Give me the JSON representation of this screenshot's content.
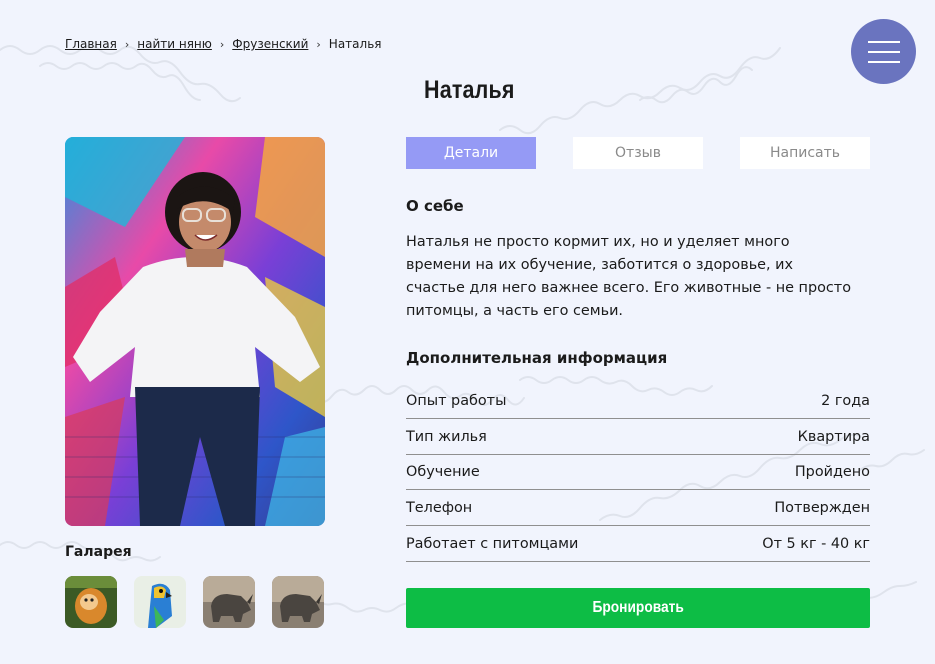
{
  "breadcrumb": {
    "items": [
      "Главная",
      "найти няню",
      "Фрузенский"
    ],
    "current": "Наталья"
  },
  "page": {
    "title": "Наталья"
  },
  "tabs": [
    {
      "label": "Детали",
      "active": true
    },
    {
      "label": "Отзыв",
      "active": false
    },
    {
      "label": "Написать",
      "active": false
    }
  ],
  "about": {
    "title": "О себе",
    "lines": [
      "Наталья не просто кормит их, но и уделяет много",
      "времени на их обучение, заботится о здоровье, их",
      "счастье для него важнее всего. Его животные - не просто",
      "питомцы, а часть его семьи."
    ]
  },
  "additional": {
    "title": "Дополнительная информация",
    "rows": [
      {
        "label": "Опыт работы",
        "value": "2 года"
      },
      {
        "label": "Тип жилья",
        "value": "Квартира"
      },
      {
        "label": "Обучение",
        "value": "Пройдено"
      },
      {
        "label": "Телефон",
        "value": "Потвержден"
      },
      {
        "label": "Работает с питомцами",
        "value": "От 5 кг - 40 кг"
      }
    ]
  },
  "gallery": {
    "title": "Галарея",
    "items": [
      "monkey-photo",
      "parrot-photo",
      "rhino-photo",
      "rhino-photo"
    ]
  },
  "book_button": {
    "label": "Бронировать"
  },
  "colors": {
    "background": "#f1f4fd",
    "menu_button": "#6a74bf",
    "active_tab": "#959af5",
    "book_button": "#0dbd45"
  },
  "icons": {
    "menu": "hamburger-icon",
    "separator": "chevron-right-icon"
  }
}
